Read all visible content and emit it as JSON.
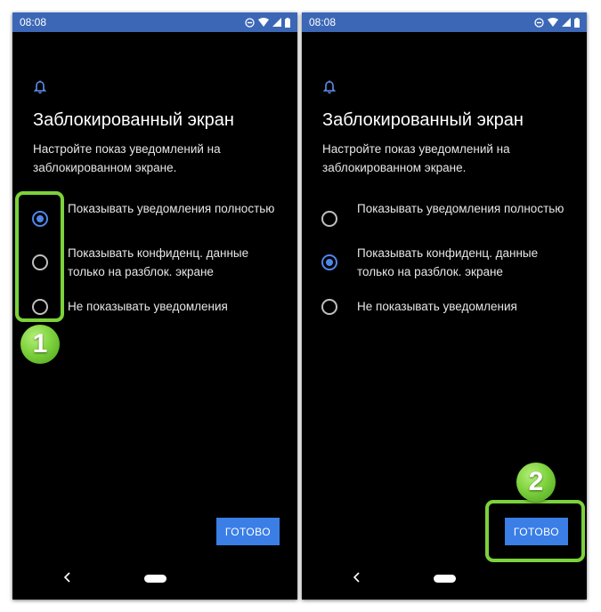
{
  "status_bar": {
    "time": "08:08"
  },
  "screen": {
    "title": "Заблокированный экран",
    "subtitle": "Настройте показ уведомлений на заблокированном экране.",
    "options": [
      {
        "label": "Показывать уведомления полностью"
      },
      {
        "label": "Показывать конфиденц. данные только на разблок. экране"
      },
      {
        "label": "Не показывать уведомления"
      }
    ],
    "done_label": "ГОТОВО"
  },
  "left_screen": {
    "selected_option": 0
  },
  "right_screen": {
    "selected_option": 1
  },
  "annotations": {
    "step1": "1",
    "step2": "2",
    "highlight_color": "#7bd23b"
  },
  "colors": {
    "status_bar": "#3c67b6",
    "accent": "#3a7ee6"
  }
}
